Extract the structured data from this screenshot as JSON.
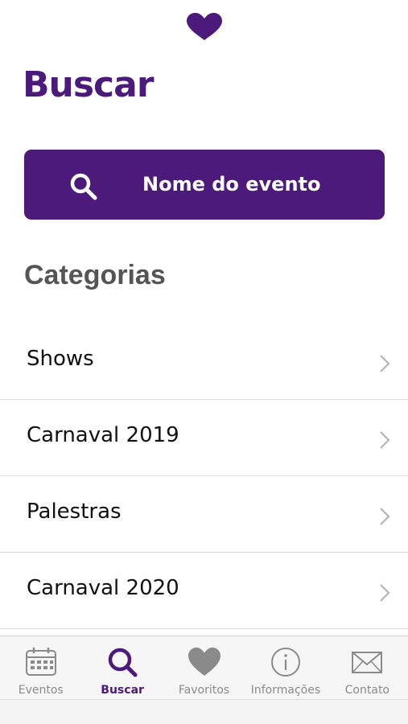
{
  "header": {
    "logo_icon": "heart-icon",
    "title": "Buscar"
  },
  "search": {
    "icon": "search-icon",
    "label": "Nome do evento"
  },
  "categories": {
    "title": "Categorias",
    "items": [
      {
        "label": "Shows"
      },
      {
        "label": "Carnaval 2019"
      },
      {
        "label": "Palestras"
      },
      {
        "label": "Carnaval 2020"
      }
    ]
  },
  "tab_bar": {
    "tabs": [
      {
        "label": "Eventos",
        "icon": "calendar-icon",
        "active": false
      },
      {
        "label": "Buscar",
        "icon": "search-icon",
        "active": true
      },
      {
        "label": "Favoritos",
        "icon": "heart-icon",
        "active": false
      },
      {
        "label": "Informações",
        "icon": "info-icon",
        "active": false
      },
      {
        "label": "Contato",
        "icon": "envelope-icon",
        "active": false
      }
    ]
  },
  "colors": {
    "brand_purple": "#4b1a7a",
    "inactive_gray": "#8a8a8a"
  }
}
